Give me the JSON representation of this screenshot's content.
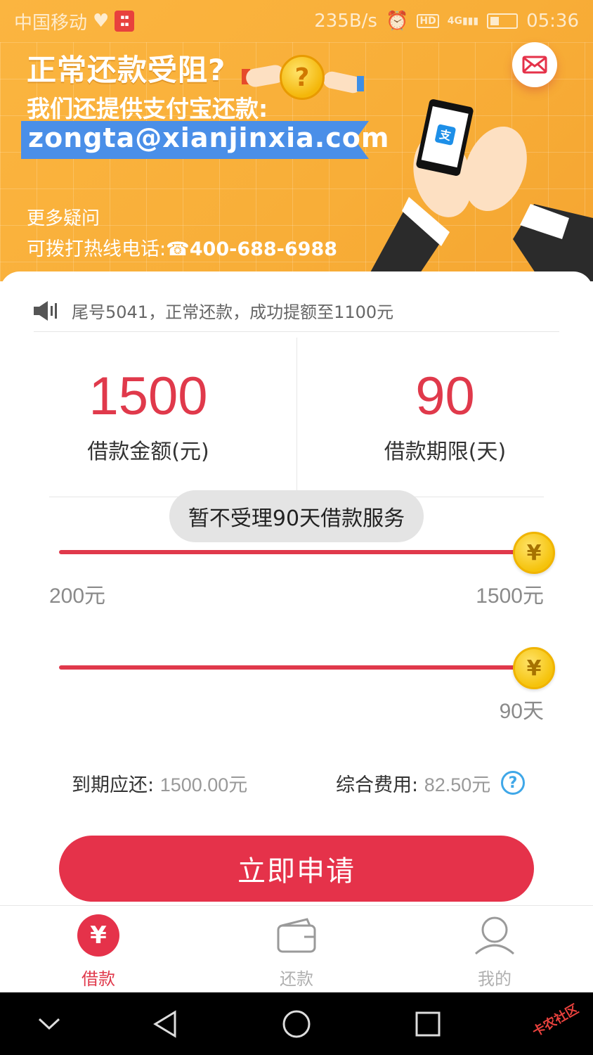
{
  "status_bar": {
    "carrier": "中国移动",
    "speed": "235B/s",
    "hd": "HD",
    "network": "4G",
    "time": "05:36"
  },
  "banner": {
    "title": "正常还款受阻?",
    "subtitle": "我们还提供支付宝还款:",
    "email": "zongta@xianjinxia.com",
    "more_questions": "更多疑问",
    "hotline_label": "可拨打热线电话:",
    "hotline_number": "400-688-6988",
    "coin_symbol": "?"
  },
  "notice": {
    "text": "尾号5041，正常还款，成功提额至1100元"
  },
  "loan": {
    "amount_value": "1500",
    "amount_label": "借款金额(元)",
    "term_value": "90",
    "term_label": "借款期限(天)",
    "amount_fraction": 1.0,
    "term_fraction": 1.0
  },
  "toast": {
    "text": "暂不受理90天借款服务"
  },
  "slider_amount": {
    "min_label": "200元",
    "max_label": "1500元",
    "knob_symbol": "¥"
  },
  "slider_term": {
    "max_label": "90天",
    "knob_symbol": "¥"
  },
  "summary": {
    "due_label": "到期应还:",
    "due_value": "1500.00元",
    "fee_label": "综合费用:",
    "fee_value": "82.50元",
    "help_symbol": "?"
  },
  "apply_button": {
    "label": "立即申请"
  },
  "tabs": [
    {
      "label": "借款",
      "icon": "yen-icon",
      "active": true
    },
    {
      "label": "还款",
      "icon": "wallet-icon",
      "active": false
    },
    {
      "label": "我的",
      "icon": "user-icon",
      "active": false
    }
  ],
  "tab_yen_symbol": "¥",
  "watermark": "卡农社区",
  "colors": {
    "accent": "#e5324a",
    "banner": "#f8ae38",
    "email_ribbon": "#4a8fe8",
    "help": "#3fa7e8",
    "knob": "#f5c30c"
  }
}
